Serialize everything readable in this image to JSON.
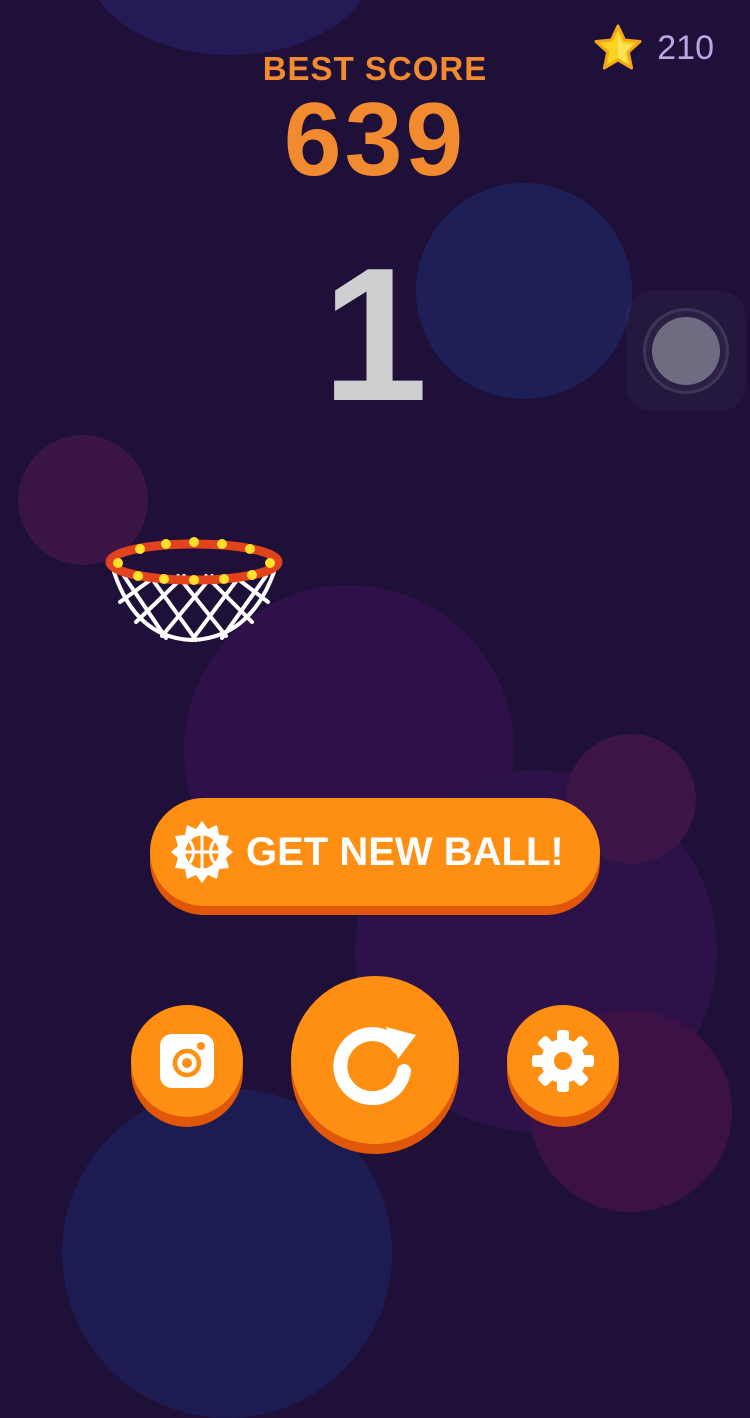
{
  "header": {
    "coins": "210",
    "best_score_label": "BEST SCORE",
    "best_score_value": "639"
  },
  "game": {
    "current_score": "1"
  },
  "buttons": {
    "new_ball_label": "GET NEW BALL!",
    "instagram_icon": "instagram-icon",
    "restart_icon": "restart-icon",
    "settings_icon": "gear-icon"
  },
  "colors": {
    "background": "#1e1038",
    "accent_orange": "#ff8f12",
    "score_orange": "#f28a30",
    "star_yellow": "#ffd21e",
    "hoop_rim": "#e2421c",
    "hoop_lights": "#ffe02c"
  }
}
